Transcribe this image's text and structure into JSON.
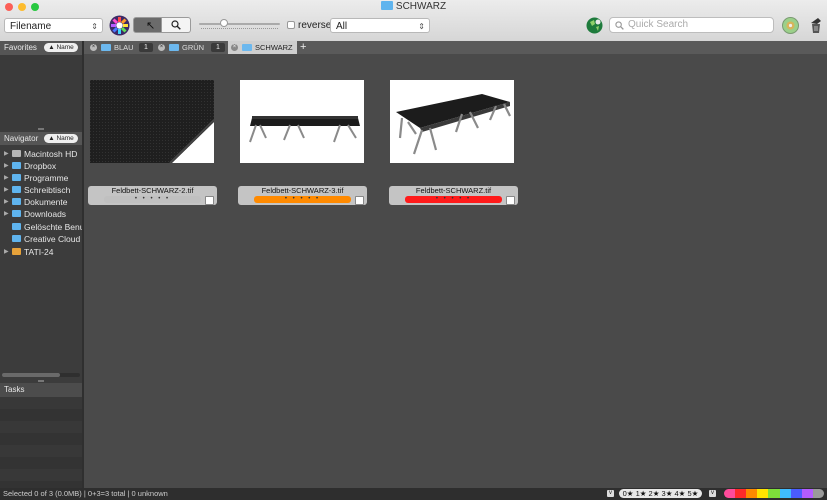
{
  "window": {
    "title": "SCHWARZ"
  },
  "toolbar": {
    "sort_field": "Filename",
    "reverse_label": "reverse",
    "filter_value": "All",
    "search_placeholder": "Quick Search"
  },
  "sidebar": {
    "favorites_label": "Favorites",
    "favorites_sort": "▲ Name",
    "navigator_label": "Navigator",
    "navigator_sort": "▲ Name",
    "tasks_label": "Tasks",
    "items": [
      {
        "label": "Macintosh HD",
        "expandable": true,
        "icon": "drive-icon"
      },
      {
        "label": "Dropbox",
        "expandable": true,
        "icon": "folder-icon"
      },
      {
        "label": "Programme",
        "expandable": true,
        "icon": "folder-icon"
      },
      {
        "label": "Schreibtisch",
        "expandable": true,
        "icon": "folder-icon"
      },
      {
        "label": "Dokumente",
        "expandable": true,
        "icon": "folder-icon"
      },
      {
        "label": "Downloads",
        "expandable": true,
        "icon": "folder-icon"
      },
      {
        "label": "Gelöschte Benu",
        "expandable": false,
        "icon": "folder-icon"
      },
      {
        "label": "Creative Cloud",
        "expandable": false,
        "icon": "folder-icon"
      },
      {
        "label": "TATI-24",
        "expandable": true,
        "icon": "external-drive-icon"
      }
    ]
  },
  "tabs": [
    {
      "label": "BLAU",
      "count": "1"
    },
    {
      "label": "GRÜN",
      "count": "1"
    },
    {
      "label": "SCHWARZ",
      "count": ""
    }
  ],
  "add_tab_label": "+",
  "files": [
    {
      "name": "Feldbett-SCHWARZ-2.tif",
      "label_color": "#c0c0c0",
      "rating": "• • • • •"
    },
    {
      "name": "Feldbett-SCHWARZ-3.tif",
      "label_color": "#ff8a00",
      "rating": "• • • • •"
    },
    {
      "name": "Feldbett-SCHWARZ.tif",
      "label_color": "#ff1a1a",
      "rating": "• • • • •"
    }
  ],
  "status": {
    "text": "Selected 0 of 3 (0.0MB) | 0+3=3 total | 0 unknown",
    "rating_filter": "0★ 1★ 2★ 3★ 4★ 5★"
  },
  "colors": {
    "label_swatches": [
      "#ff4b9b",
      "#ff2a2a",
      "#ff8a00",
      "#ffe400",
      "#7ee03a",
      "#3fbcff",
      "#4a5cff",
      "#b35cff",
      "#9a9a9a"
    ]
  }
}
